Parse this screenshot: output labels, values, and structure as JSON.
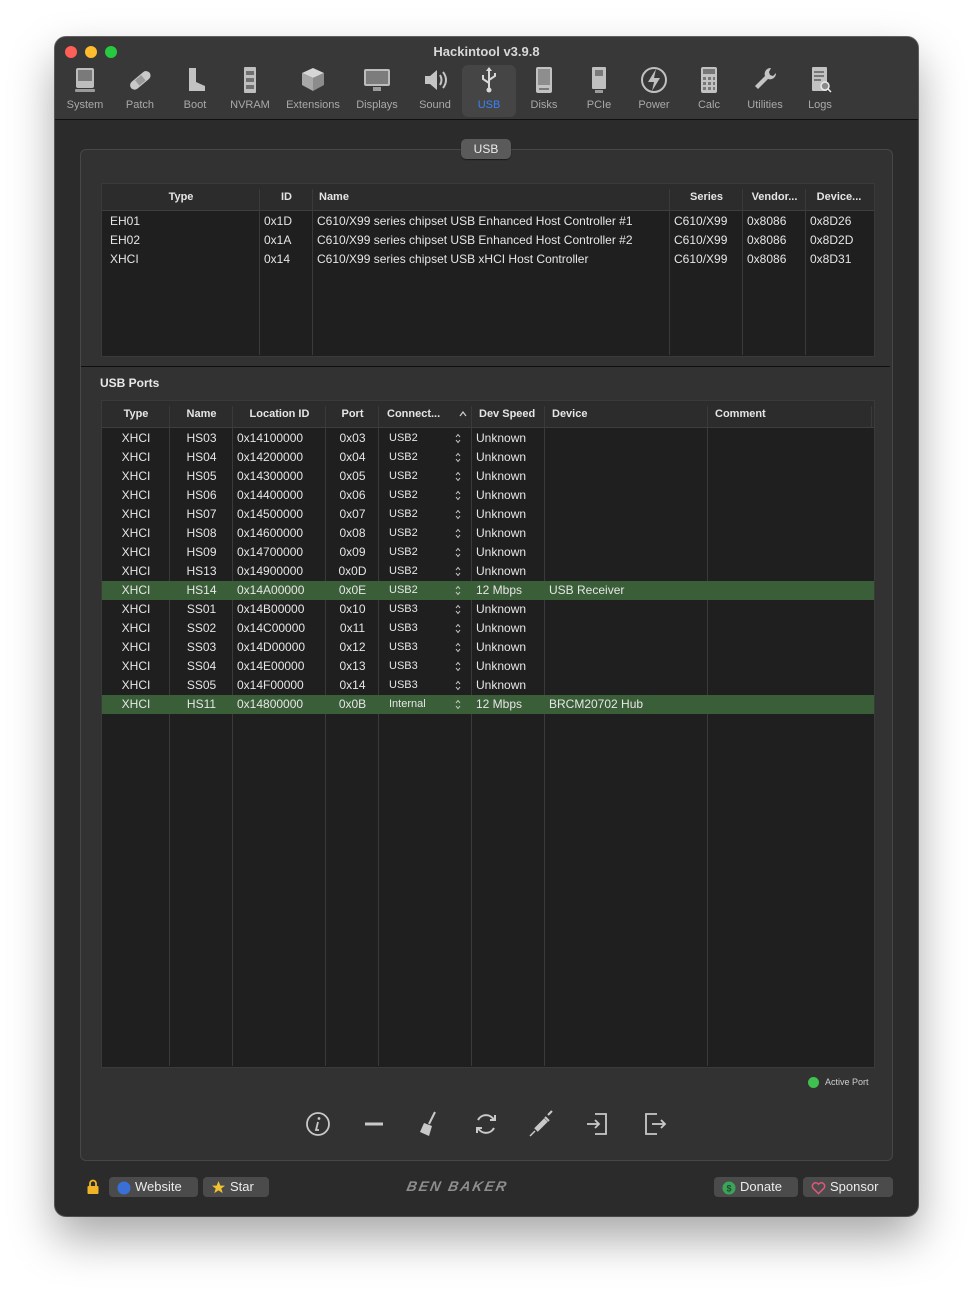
{
  "window": {
    "title": "Hackintool v3.9.8"
  },
  "toolbar": {
    "items": [
      {
        "label": "System",
        "icon": "computer-icon"
      },
      {
        "label": "Patch",
        "icon": "bandage-icon"
      },
      {
        "label": "Boot",
        "icon": "boot-icon"
      },
      {
        "label": "NVRAM",
        "icon": "memory-icon"
      },
      {
        "label": "Extensions",
        "icon": "extensions-box-icon"
      },
      {
        "label": "Displays",
        "icon": "display-icon"
      },
      {
        "label": "Sound",
        "icon": "speaker-icon"
      },
      {
        "label": "USB",
        "icon": "usb-icon"
      },
      {
        "label": "Disks",
        "icon": "disk-icon"
      },
      {
        "label": "PCIe",
        "icon": "pcie-card-icon"
      },
      {
        "label": "Power",
        "icon": "power-bolt-icon"
      },
      {
        "label": "Calc",
        "icon": "calculator-icon"
      },
      {
        "label": "Utilities",
        "icon": "wrench-icon"
      },
      {
        "label": "Logs",
        "icon": "log-document-icon"
      }
    ],
    "selected": "USB",
    "selected_color": "#3b82f6"
  },
  "panel": {
    "tab_label": "USB"
  },
  "controllers": {
    "headers": [
      "Type",
      "ID",
      "Name",
      "Series",
      "Vendor...",
      "Device..."
    ],
    "rows": [
      [
        "EH01",
        "0x1D",
        "C610/X99 series chipset USB Enhanced Host Controller #1",
        "C610/X99",
        "0x8086",
        "0x8D26"
      ],
      [
        "EH02",
        "0x1A",
        "C610/X99 series chipset USB Enhanced Host Controller #2",
        "C610/X99",
        "0x8086",
        "0x8D2D"
      ],
      [
        "XHCI",
        "0x14",
        "C610/X99 series chipset USB xHCI Host Controller",
        "C610/X99",
        "0x8086",
        "0x8D31"
      ]
    ]
  },
  "ports": {
    "section_label": "USB Ports",
    "headers": [
      "Type",
      "Name",
      "Location ID",
      "Port",
      "Connect...",
      "Dev Speed",
      "Device",
      "Comment"
    ],
    "rows": [
      {
        "cells": [
          "XHCI",
          "HS03",
          "0x14100000",
          "0x03",
          "USB2",
          "Unknown",
          "",
          ""
        ],
        "active": false
      },
      {
        "cells": [
          "XHCI",
          "HS04",
          "0x14200000",
          "0x04",
          "USB2",
          "Unknown",
          "",
          ""
        ],
        "active": false
      },
      {
        "cells": [
          "XHCI",
          "HS05",
          "0x14300000",
          "0x05",
          "USB2",
          "Unknown",
          "",
          ""
        ],
        "active": false
      },
      {
        "cells": [
          "XHCI",
          "HS06",
          "0x14400000",
          "0x06",
          "USB2",
          "Unknown",
          "",
          ""
        ],
        "active": false
      },
      {
        "cells": [
          "XHCI",
          "HS07",
          "0x14500000",
          "0x07",
          "USB2",
          "Unknown",
          "",
          ""
        ],
        "active": false
      },
      {
        "cells": [
          "XHCI",
          "HS08",
          "0x14600000",
          "0x08",
          "USB2",
          "Unknown",
          "",
          ""
        ],
        "active": false
      },
      {
        "cells": [
          "XHCI",
          "HS09",
          "0x14700000",
          "0x09",
          "USB2",
          "Unknown",
          "",
          ""
        ],
        "active": false
      },
      {
        "cells": [
          "XHCI",
          "HS13",
          "0x14900000",
          "0x0D",
          "USB2",
          "Unknown",
          "",
          ""
        ],
        "active": false
      },
      {
        "cells": [
          "XHCI",
          "HS14",
          "0x14A00000",
          "0x0E",
          "USB2",
          "12 Mbps",
          "USB Receiver",
          ""
        ],
        "active": true
      },
      {
        "cells": [
          "XHCI",
          "SS01",
          "0x14B00000",
          "0x10",
          "USB3",
          "Unknown",
          "",
          ""
        ],
        "active": false
      },
      {
        "cells": [
          "XHCI",
          "SS02",
          "0x14C00000",
          "0x11",
          "USB3",
          "Unknown",
          "",
          ""
        ],
        "active": false
      },
      {
        "cells": [
          "XHCI",
          "SS03",
          "0x14D00000",
          "0x12",
          "USB3",
          "Unknown",
          "",
          ""
        ],
        "active": false
      },
      {
        "cells": [
          "XHCI",
          "SS04",
          "0x14E00000",
          "0x13",
          "USB3",
          "Unknown",
          "",
          ""
        ],
        "active": false
      },
      {
        "cells": [
          "XHCI",
          "SS05",
          "0x14F00000",
          "0x14",
          "USB3",
          "Unknown",
          "",
          ""
        ],
        "active": false
      },
      {
        "cells": [
          "XHCI",
          "HS11",
          "0x14800000",
          "0x0B",
          "Internal",
          "12 Mbps",
          "BRCM20702 Hub",
          ""
        ],
        "active": true
      }
    ],
    "active_row_color": "#3a5e38"
  },
  "legend": {
    "label": "Active Port",
    "color": "#3fc04f"
  },
  "actions": [
    "info-icon",
    "remove-icon",
    "broom-clear-icon",
    "refresh-icon",
    "syringe-inject-icon",
    "import-icon",
    "export-icon"
  ],
  "footer": {
    "website_label": "Website",
    "star_label": "Star",
    "brand": "BEN BAKER",
    "donate_label": "Donate",
    "sponsor_label": "Sponsor"
  }
}
